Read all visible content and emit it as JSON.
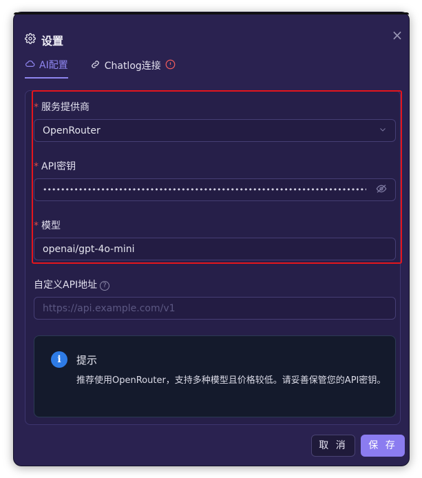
{
  "dialog": {
    "title": "设置",
    "close_label": "×"
  },
  "tabs": [
    {
      "label": "AI配置",
      "icon": "cloud-icon",
      "active": true
    },
    {
      "label": "Chatlog连接",
      "icon": "link-icon",
      "active": false,
      "badge_icon": "warning-icon"
    }
  ],
  "form": {
    "provider": {
      "label": "服务提供商",
      "required": "*",
      "value": "OpenRouter"
    },
    "api_key": {
      "label": "API密钥",
      "required": "*",
      "value": "••••••••••••••••••••••••••••••••••••••••••••••••••••••••••••••••••••••••••••••"
    },
    "model": {
      "label": "模型",
      "required": "*",
      "value": "openai/gpt-4o-mini"
    },
    "custom_api": {
      "label": "自定义API地址",
      "placeholder": "https://api.example.com/v1",
      "help": "?"
    }
  },
  "tip": {
    "title": "提示",
    "body": "推荐使用OpenRouter，支持多种模型且价格较低。请妥善保管您的API密钥。"
  },
  "footer": {
    "cancel_label": "取 消",
    "save_label": "保 存"
  },
  "colors": {
    "accent": "#8b7cf0",
    "highlight_box": "#e5151c",
    "info": "#2e7be6",
    "warning": "#f05c5c"
  }
}
